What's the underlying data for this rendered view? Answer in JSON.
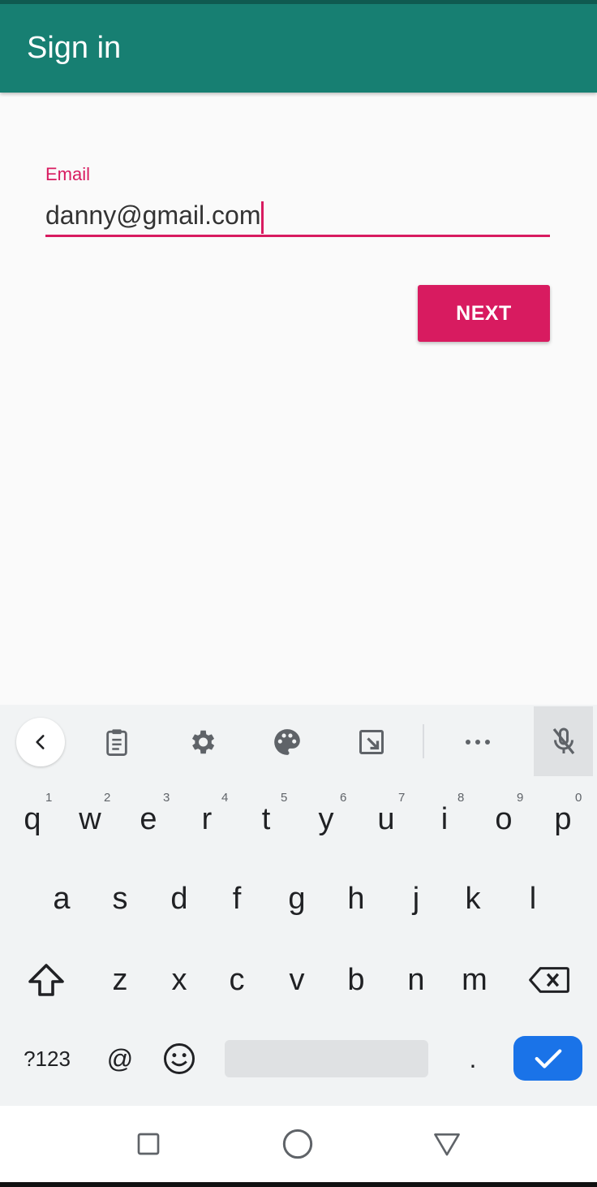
{
  "app_bar": {
    "title": "Sign in",
    "color": "#177f72"
  },
  "form": {
    "email_label": "Email",
    "email_value": "danny@gmail.com",
    "accent_color": "#d81b60",
    "next_label": "NEXT"
  },
  "keyboard": {
    "toolbar_icons": [
      "back-icon",
      "clipboard-icon",
      "gear-icon",
      "palette-icon",
      "resize-icon",
      "more-icon",
      "mic-off-icon"
    ],
    "row1": [
      {
        "char": "q",
        "hint": "1"
      },
      {
        "char": "w",
        "hint": "2"
      },
      {
        "char": "e",
        "hint": "3"
      },
      {
        "char": "r",
        "hint": "4"
      },
      {
        "char": "t",
        "hint": "5"
      },
      {
        "char": "y",
        "hint": "6"
      },
      {
        "char": "u",
        "hint": "7"
      },
      {
        "char": "i",
        "hint": "8"
      },
      {
        "char": "o",
        "hint": "9"
      },
      {
        "char": "p",
        "hint": "0"
      }
    ],
    "row2": [
      "a",
      "s",
      "d",
      "f",
      "g",
      "h",
      "j",
      "k",
      "l"
    ],
    "row3": [
      "z",
      "x",
      "c",
      "v",
      "b",
      "n",
      "m"
    ],
    "symbols_label": "?123",
    "at_label": "@",
    "period_label": ".",
    "enter_color": "#1a73e8"
  },
  "nav_bar": {
    "icons": [
      "recents-icon",
      "home-icon",
      "back-nav-icon"
    ]
  }
}
